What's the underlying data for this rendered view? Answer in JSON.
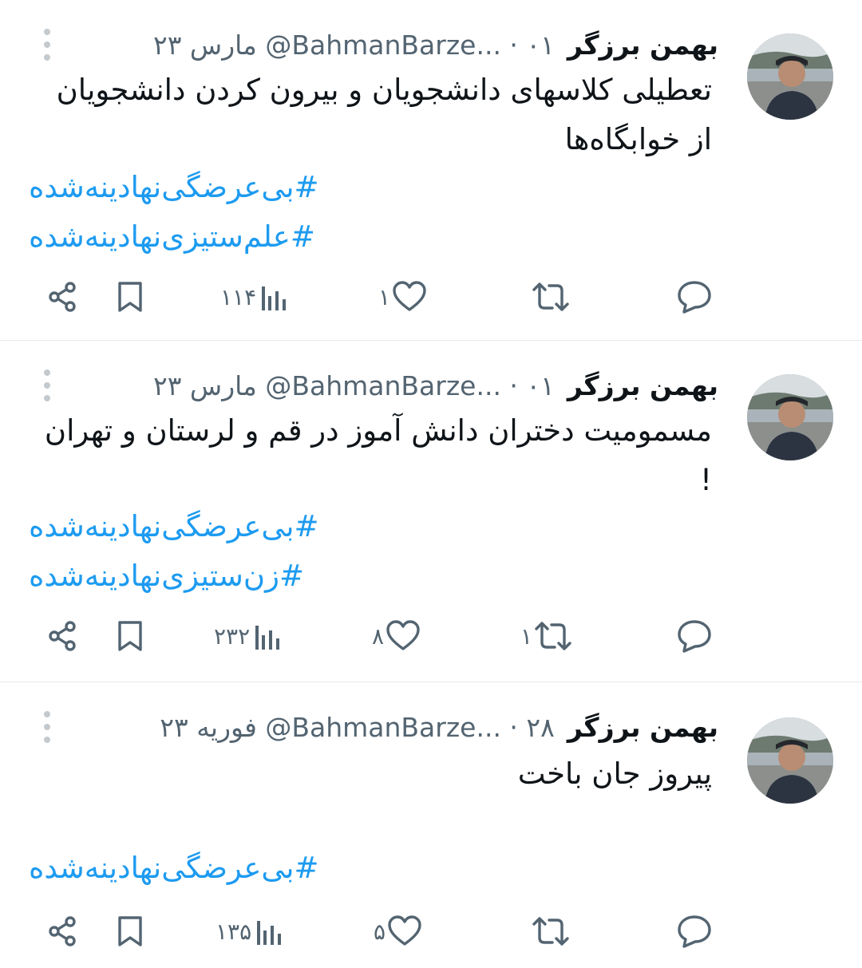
{
  "tweets": [
    {
      "author_name": "بهمن برزگر",
      "meta": "‎@BahmanBarze... · ۰۱ مارس ۲۳",
      "text": "تعطیلی کلاسهای دانشجویان و بیرون کردن دانشجویان از خوابگاه‌ها",
      "hashtags": [
        "#بی‌عرضگی‌نهادینه‌شده",
        "#علم‌ستیزی‌نهادینه‌شده"
      ],
      "views": "۱۱۴",
      "likes": "۱",
      "retweets": "",
      "replies": ""
    },
    {
      "author_name": "بهمن برزگر",
      "meta": "‎@BahmanBarze... · ۰۱ مارس ۲۳",
      "text": "مسمومیت دختران دانش آموز در قم و لرستان و تهران !",
      "hashtags": [
        "#بی‌عرضگی‌نهادینه‌شده",
        "#زن‌ستیزی‌نهادینه‌شده"
      ],
      "views": "۲۳۲",
      "likes": "۸",
      "retweets": "۱",
      "replies": ""
    },
    {
      "author_name": "بهمن برزگر",
      "meta": "‎@BahmanBarze... · ۲۸ فوریه ۲۳",
      "text": "پیروز جان باخت",
      "hashtags": [
        "#بی‌عرضگی‌نهادینه‌شده"
      ],
      "views": "۱۳۵",
      "likes": "۵",
      "retweets": "",
      "replies": ""
    }
  ],
  "icons": {
    "reply": "reply-icon",
    "retweet": "retweet-icon",
    "like": "heart-icon",
    "views": "views-chart-icon",
    "bookmark": "bookmark-icon",
    "share": "share-icon",
    "more": "more-vertical-icon"
  },
  "colors": {
    "text": "#0f1419",
    "secondary": "#536471",
    "hashtag": "#1d9bf0",
    "divider": "#e6e9eb"
  }
}
